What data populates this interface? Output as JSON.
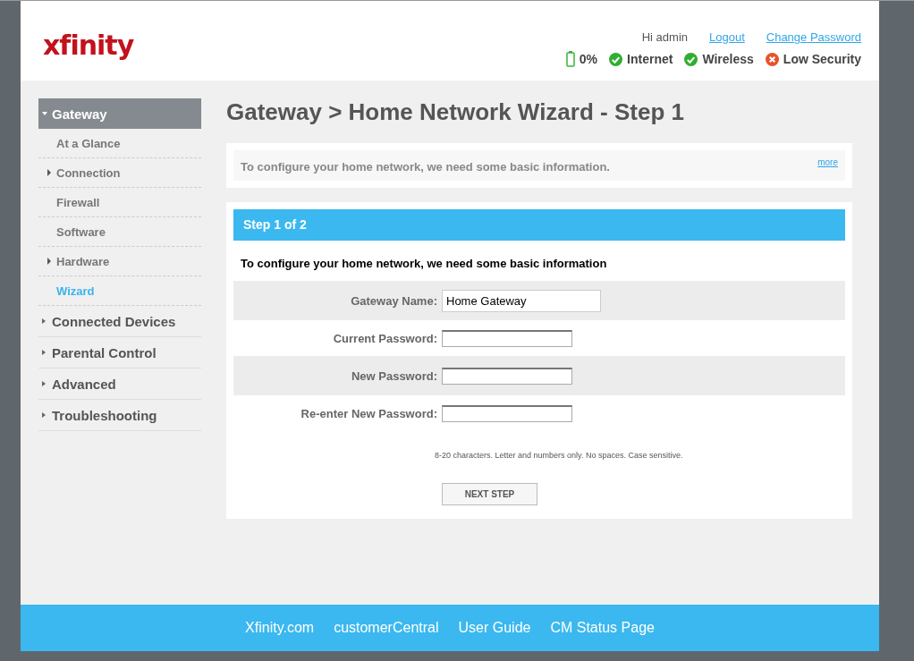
{
  "header": {
    "logo": "xfinity",
    "greeting": "Hi admin",
    "links": [
      "Logout",
      "Change Password"
    ],
    "status": [
      {
        "kind": "battery",
        "label": "0%"
      },
      {
        "kind": "ok",
        "label": "Internet"
      },
      {
        "kind": "ok",
        "label": "Wireless"
      },
      {
        "kind": "error",
        "label": "Low Security"
      }
    ]
  },
  "sidebar": {
    "items": [
      {
        "label": "Gateway",
        "expanded": true,
        "children": [
          {
            "label": "At a Glance",
            "has_children": false,
            "selected": false
          },
          {
            "label": "Connection",
            "has_children": true,
            "selected": false
          },
          {
            "label": "Firewall",
            "has_children": false,
            "selected": false
          },
          {
            "label": "Software",
            "has_children": false,
            "selected": false
          },
          {
            "label": "Hardware",
            "has_children": true,
            "selected": false
          },
          {
            "label": "Wizard",
            "has_children": false,
            "selected": true
          }
        ]
      },
      {
        "label": "Connected Devices",
        "expanded": false
      },
      {
        "label": "Parental Control",
        "expanded": false
      },
      {
        "label": "Advanced",
        "expanded": false
      },
      {
        "label": "Troubleshooting",
        "expanded": false
      }
    ]
  },
  "page_title": "Gateway > Home Network Wizard - Step 1",
  "info": {
    "text": "To configure your home network, we need some basic information.",
    "more": "more"
  },
  "wizard": {
    "step": "Step 1 of 2",
    "intro": "To configure your home network, we need some basic information",
    "fields": [
      {
        "label": "Gateway Name:",
        "kind": "text",
        "value": "Home Gateway"
      },
      {
        "label": "Current Password:",
        "kind": "password"
      },
      {
        "label": "New Password:",
        "kind": "password"
      },
      {
        "label": "Re-enter New Password:",
        "kind": "password"
      }
    ],
    "hint": "8-20 characters. Letter and numbers only. No spaces. Case sensitive.",
    "button": "NEXT STEP"
  },
  "footer": {
    "links": [
      "Xfinity.com",
      "customerCentral",
      "User Guide",
      "CM Status Page"
    ]
  }
}
